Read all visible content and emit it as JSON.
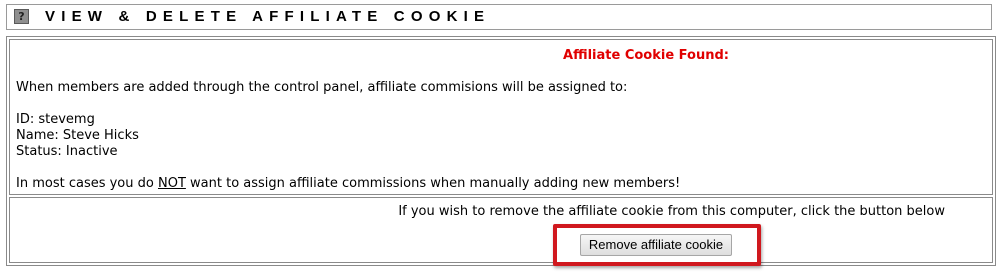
{
  "header": {
    "help_icon_label": "?",
    "title": "VIEW & DELETE AFFILIATE COOKIE"
  },
  "info": {
    "found_title": "Affiliate Cookie Found:",
    "intro": "When members are added through the control panel, affiliate commisions will be assigned to:",
    "id_line": "ID: stevemg",
    "name_line": "Name: Steve Hicks",
    "status_line": "Status: Inactive",
    "warning_prefix": "In most cases you do ",
    "warning_emphasis": "NOT",
    "warning_suffix": " want to assign affiliate commissions when manually adding new members!"
  },
  "action": {
    "instruction": "If you wish to remove the affiliate cookie from this computer, click the button below",
    "button_label": "Remove affiliate cookie"
  },
  "colors": {
    "found_title": "#e00000",
    "highlight_border": "#d0181e",
    "table_border": "#8a8a8a"
  },
  "icons": {
    "help": "help-icon"
  }
}
